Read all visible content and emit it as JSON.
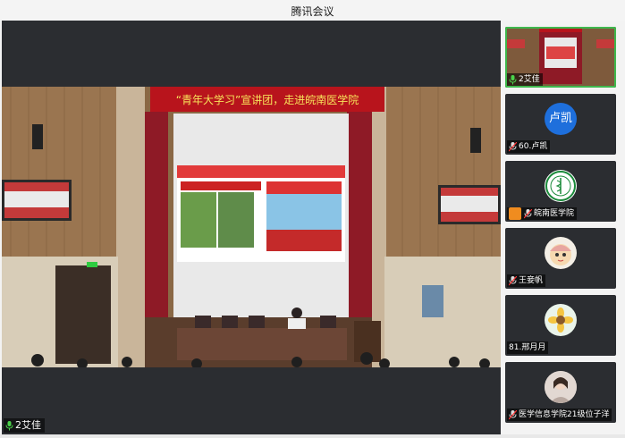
{
  "window": {
    "title": "腾讯会议"
  },
  "main_video": {
    "speaker_name": "2艾佳",
    "banner_text": "“青年大学习”宣讲团，走进皖南医学院",
    "slide_caption": "青年只有永远奔跑不停，才能成为新时代的担当者"
  },
  "participants": [
    {
      "name": "2艾佳",
      "type": "video",
      "active": true
    },
    {
      "name": "60.卢凯",
      "type": "initials",
      "initials": "卢凯",
      "color": "#1e6fdc"
    },
    {
      "name": "皖南医学院",
      "type": "logo",
      "host": true
    },
    {
      "name": "王妾帆",
      "type": "cartoon"
    },
    {
      "name": "81.邢月月",
      "type": "flower"
    },
    {
      "name": "医学信息学院21级位子洋",
      "type": "photo"
    }
  ]
}
